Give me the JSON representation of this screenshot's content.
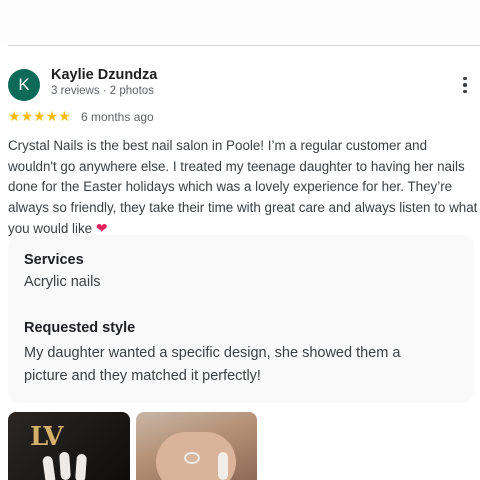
{
  "review": {
    "avatar_letter": "K",
    "author": "Kaylie Dzundza",
    "meta": "3 reviews · 2 photos",
    "rating": 5,
    "stars": [
      "★",
      "★",
      "★",
      "★",
      "★"
    ],
    "time": "6 months ago",
    "text": "Crystal Nails is the best nail salon in Poole! I’m a regular customer and wouldn't go anywhere else. I treated my teenage daughter to having her nails done for the Easter holidays which was a lovely experience for her. They’re always so friendly, they take their time with great care and always listen to what you would like",
    "emoji": "❤",
    "services_label": "Services",
    "services_value": "Acrylic nails",
    "style_label": "Requested style",
    "style_value": "My daughter wanted a specific design, she showed them a picture and they matched it perfectly!"
  },
  "photos": [
    {
      "logo_text": "LV"
    },
    {}
  ],
  "colors": {
    "avatar": "#0d6a57",
    "star": "#fbbc04",
    "heart": "#e0245e",
    "panel": "#f9f9f9"
  },
  "icons": {
    "more": "more-vert-icon",
    "star": "star-icon",
    "heart": "heart-icon"
  }
}
